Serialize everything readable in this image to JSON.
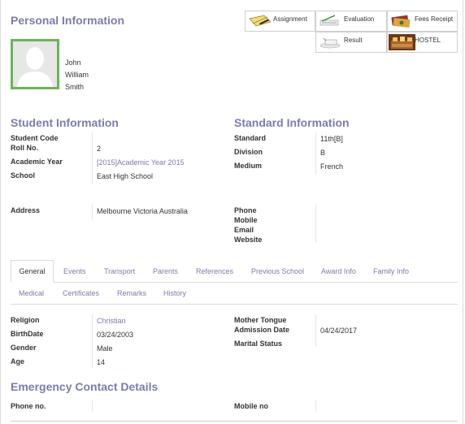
{
  "personal": {
    "title": "Personal Information",
    "first_name": "John",
    "middle_name": "William",
    "last_name": "Smith"
  },
  "smart_buttons": {
    "assignment": "Assignment",
    "evaluation": "Evaluation",
    "fees_receipt": "Fees Receipt",
    "result": "Result",
    "hostel": "HOSTEL"
  },
  "student_info": {
    "title": "Student Information",
    "student_code_label": "Student Code",
    "student_code_value": "",
    "roll_no_label": "Roll No.",
    "roll_no_value": "2",
    "academic_year_label": "Academic Year",
    "academic_year_value": "[2015]Academic Year 2015",
    "school_label": "School",
    "school_value": "East High School",
    "address_label": "Address",
    "address_value": "Melbourne Victoria Australia"
  },
  "standard_info": {
    "title": "Standard Information",
    "standard_label": "Standard",
    "standard_value": "11th[B]",
    "division_label": "Division",
    "division_value": "B",
    "medium_label": "Medium",
    "medium_value": "French",
    "phone_label": "Phone",
    "mobile_label": "Mobile",
    "email_label": "Email",
    "website_label": "Website"
  },
  "tabs": {
    "general": "General",
    "events": "Events",
    "transport": "Transport",
    "parents": "Parents",
    "references": "References",
    "previous_school": "Previous School",
    "award_info": "Award Info",
    "family_info": "Family Info",
    "medical": "Medical",
    "certificates": "Certificates",
    "remarks": "Remarks",
    "history": "History"
  },
  "general": {
    "religion_label": "Religion",
    "religion_value": "Christian",
    "birthdate_label": "BirthDate",
    "birthdate_value": "03/24/2003",
    "gender_label": "Gender",
    "gender_value": "Male",
    "age_label": "Age",
    "age_value": "14",
    "mother_tongue_label": "Mother Tongue",
    "admission_date_label": "Admission Date",
    "admission_date_value": "04/24/2017",
    "marital_status_label": "Marital Status"
  },
  "emergency": {
    "title": "Emergency Contact Details",
    "phone_label": "Phone no.",
    "mobile_label": "Mobile no"
  },
  "colors": {
    "accent": "#7c7bad",
    "avatar_bg": "#6db35a"
  },
  "icons": [
    "assignment-icon",
    "evaluation-icon",
    "fees-receipt-icon",
    "result-icon",
    "hostel-icon",
    "avatar-icon"
  ]
}
